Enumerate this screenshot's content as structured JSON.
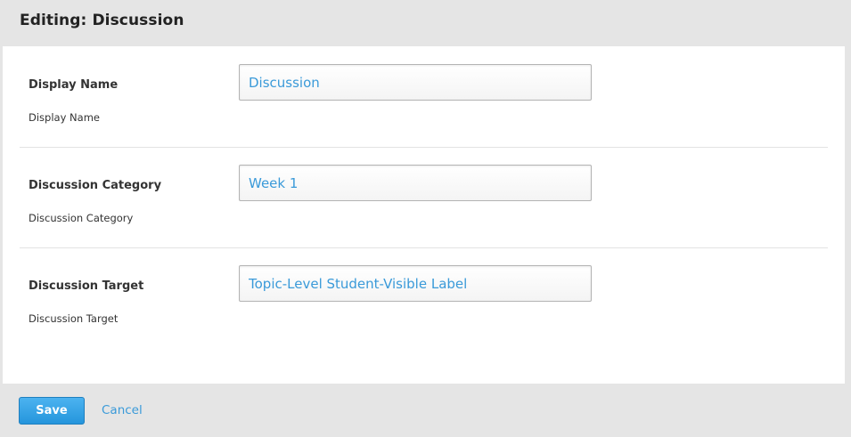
{
  "header": {
    "title": "Editing: Discussion"
  },
  "fields": [
    {
      "label": "Display Name",
      "help": "Display Name",
      "value": "Discussion"
    },
    {
      "label": "Discussion Category",
      "help": "Discussion Category",
      "value": "Week 1"
    },
    {
      "label": "Discussion Target",
      "help": "Discussion Target",
      "value": "Topic-Level Student-Visible Label"
    }
  ],
  "footer": {
    "save_label": "Save",
    "cancel_label": "Cancel"
  },
  "colors": {
    "accent": "#3a9ad9",
    "save_button": "#2595dc",
    "background": "#e5e5e5"
  }
}
